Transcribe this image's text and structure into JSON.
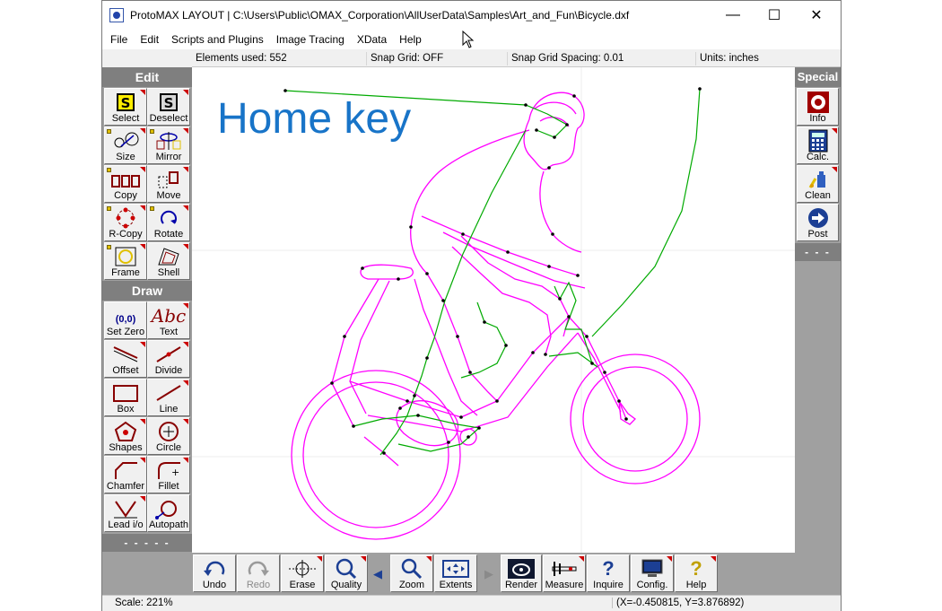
{
  "window": {
    "title": "ProtoMAX LAYOUT | C:\\Users\\Public\\OMAX_Corporation\\AllUserData\\Samples\\Art_and_Fun\\Bicycle.dxf",
    "minimize_glyph": "—",
    "maximize_glyph": "☐",
    "close_glyph": "✕"
  },
  "menu": [
    "File",
    "Edit",
    "Scripts and Plugins",
    "Image Tracing",
    "XData",
    "Help"
  ],
  "status_top": {
    "elements_used": "Elements used: 552",
    "snap_grid": "Snap Grid: OFF",
    "snap_spacing": "Snap Grid Spacing: 0.01",
    "units": "Units: inches"
  },
  "left_toolbar": {
    "edit_header": "Edit",
    "draw_header": "Draw",
    "footer": "- - - - -",
    "edit_tools": [
      "Select",
      "Deselect",
      "Size",
      "Mirror",
      "Copy",
      "Move",
      "R-Copy",
      "Rotate",
      "Frame",
      "Shell"
    ],
    "draw_tools": [
      "Set Zero",
      "Text",
      "Offset",
      "Divide",
      "Box",
      "Line",
      "Shapes",
      "Circle",
      "Chamfer",
      "Fillet",
      "Lead i/o",
      "Autopath"
    ],
    "text_icon": "Abc",
    "set_zero_icon": "(0,0)"
  },
  "right_toolbar": {
    "header": "Special",
    "footer": "- - -",
    "tools": [
      "Info",
      "Calc.",
      "Clean",
      "Post"
    ]
  },
  "canvas": {
    "overlay_text": "Home key",
    "colors": {
      "outline": "#ff00ff",
      "path": "#00aa00",
      "node": "#000000",
      "overlay": "#1874c8"
    }
  },
  "bottom_toolbar": {
    "tools": [
      "Undo",
      "Redo",
      "Erase",
      "Quality",
      "Zoom",
      "Extents",
      "Render",
      "Measure",
      "Inquire",
      "Config.",
      "Help"
    ],
    "disabled": [
      "Redo"
    ],
    "prev_glyph": "◀",
    "next_glyph": "▶"
  },
  "status_bottom": {
    "scale": "Scale: 221%",
    "coordinates": "(X=-0.450815, Y=3.876892)"
  }
}
